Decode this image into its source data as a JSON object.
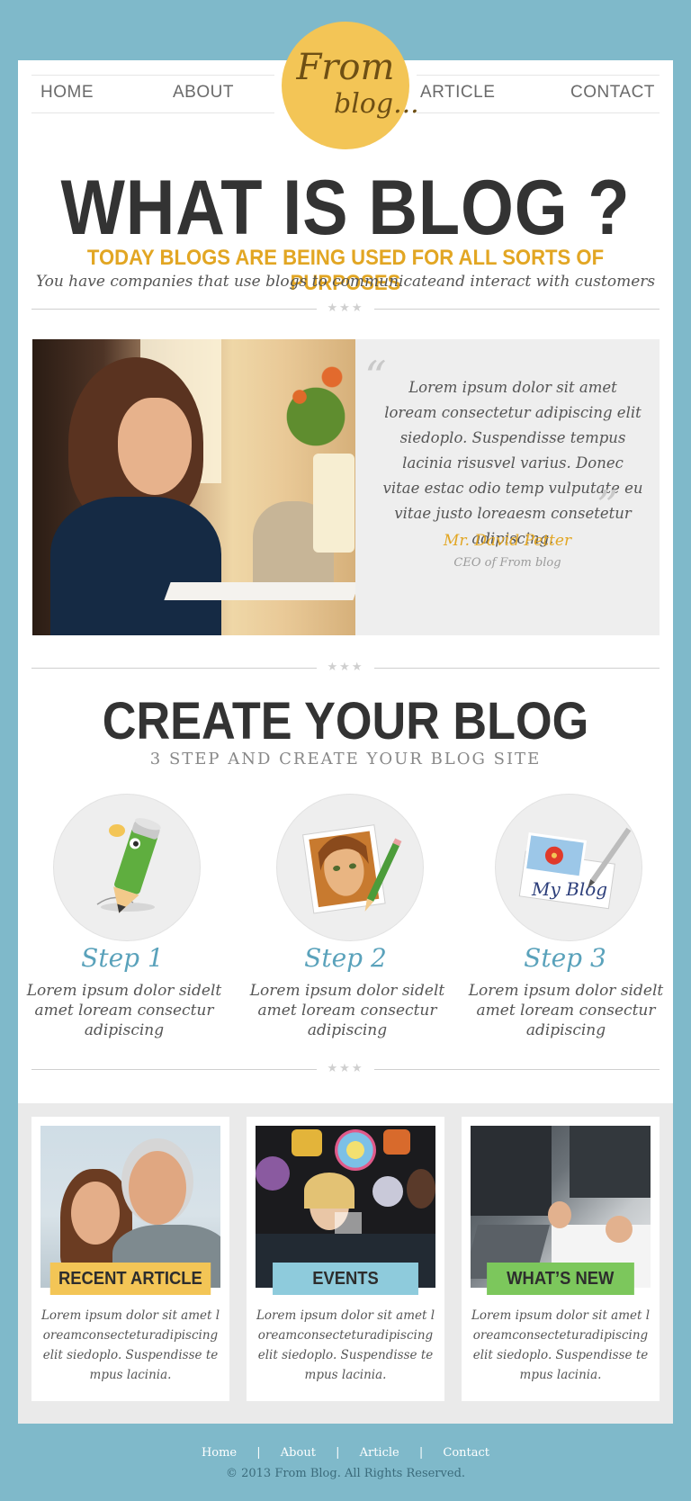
{
  "nav": {
    "home": "HOME",
    "about": "ABOUT",
    "article": "ARTICLE",
    "contact": "CONTACT"
  },
  "logo": {
    "line1": "From",
    "line2": "blog..."
  },
  "hero": {
    "title": "WHAT IS BLOG ?",
    "subtitle": "TODAY BLOGS ARE BEING USED FOR ALL SORTS OF PURPOSES",
    "description": "You have companies that use blogs to communicateand interact with customers"
  },
  "divider_stars": "★★★",
  "testimonial": {
    "quote": "Lorem ipsum dolor sit amet loream consectetur adipiscing elit siedoplo. Suspendisse tempus lacinia risusvel varius. Donec vitae estac odio temp vulputate eu vitae justo loreaesm consetetur adipiscing.",
    "author": "Mr. David Petter",
    "role": "CEO of From blog",
    "open_mark": "“",
    "close_mark": "”"
  },
  "create": {
    "title": "CREATE YOUR BLOG",
    "subtitle": "3 STEP AND CREATE YOUR BLOG SITE",
    "steps": [
      {
        "title": "Step 1",
        "text": "Lorem ipsum dolor sidelt amet loream consectur adipiscing",
        "icon": "pencil-icon"
      },
      {
        "title": "Step 2",
        "text": "Lorem ipsum dolor sidelt amet loream consectur adipiscing",
        "icon": "painting-icon"
      },
      {
        "title": "Step 3",
        "text": "Lorem ipsum dolor sidelt amet loream consectur adipiscing",
        "icon": "my-blog-letter-icon"
      }
    ],
    "step3_icon_text": "My Blog"
  },
  "cards": [
    {
      "label": "RECENT ARTICLE",
      "color": "#f3c556",
      "text": "Lorem ipsum dolor sit amet loreamconsecteturadipiscing elit siedoplo. Suspendisse tempus lacinia."
    },
    {
      "label": "EVENTS",
      "color": "#8ecbdc",
      "text": "Lorem ipsum dolor sit amet loreamconsecteturadipiscing elit siedoplo. Suspendisse tempus lacinia."
    },
    {
      "label": "WHAT’S NEW",
      "color": "#7cc75c",
      "text": "Lorem ipsum dolor sit amet loreamconsecteturadipiscing elit siedoplo. Suspendisse tempus lacinia."
    }
  ],
  "footer": {
    "links": [
      "Home",
      "About",
      "Article",
      "Contact"
    ],
    "separator": "|",
    "copyright": "© 2013 From Blog. All Rights Reserved."
  },
  "colors": {
    "background": "#7fb9ca",
    "accent_yellow": "#e2a623",
    "logo_circle": "#f3c556",
    "step_blue": "#5aa2bb"
  }
}
